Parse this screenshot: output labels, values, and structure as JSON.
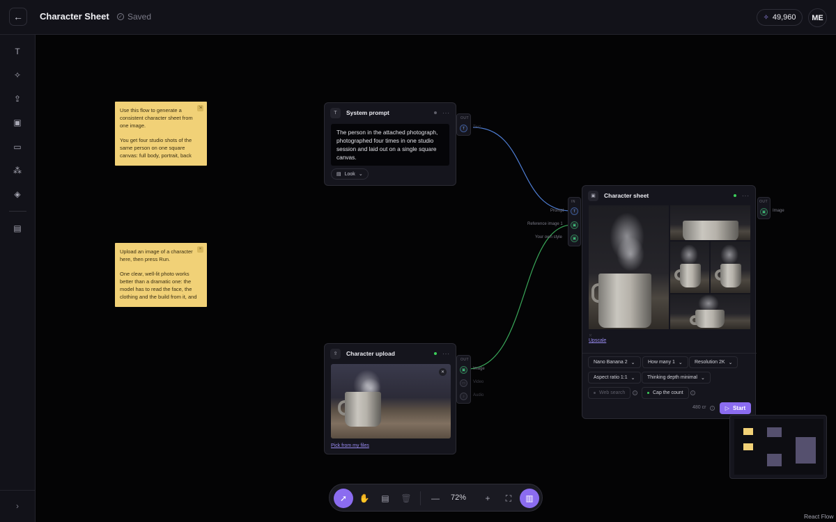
{
  "header": {
    "back_icon": "arrow-left-icon",
    "title": "Character Sheet",
    "status": "Saved",
    "credits": "49,960",
    "avatar": "ME"
  },
  "sidebar": {
    "items": [
      {
        "name": "text-tool",
        "icon": "T"
      },
      {
        "name": "sparkle-tool",
        "icon": "✧"
      },
      {
        "name": "upload-tool",
        "icon": "⇪"
      },
      {
        "name": "image-tool",
        "icon": "▣"
      },
      {
        "name": "video-tool",
        "icon": "▭"
      },
      {
        "name": "magic-wand-tool",
        "icon": "⁂"
      },
      {
        "name": "layers-tool",
        "icon": "◈"
      },
      {
        "name": "assets-tool",
        "icon": "▤"
      }
    ],
    "expand_icon": "›"
  },
  "notes": [
    {
      "p1": "Use this flow to generate a consistent character sheet from one image.",
      "p2": "You get four studio shots of the same person on one square canvas: full body, portrait, back"
    },
    {
      "p1": "Upload an image of a character here, then press Run.",
      "p2": "One clear, well-lit photo works better than a dramatic one: the model has to read the face, the clothing and the build from it, and"
    }
  ],
  "system_prompt": {
    "title": "System prompt",
    "text": "The person in the attached photograph, photographed four times in one studio session and laid out on a single square canvas.",
    "look_label": "Look",
    "out_tag": "OUT",
    "out_port": "Text"
  },
  "character_upload": {
    "title": "Character upload",
    "pick_label": "Pick from my files",
    "out_tag": "OUT",
    "ports": [
      "Image",
      "Video",
      "Audio"
    ]
  },
  "character_sheet": {
    "title": "Character sheet",
    "in_tag": "IN",
    "in_ports": [
      "Prompt",
      "Reference image 1",
      "Your own style"
    ],
    "out_tag": "OUT",
    "out_port": "Image",
    "upscale_label": "Upscale",
    "options": {
      "model": "Nano Banana 2",
      "how_many": "How many 1",
      "resolution": "Resolution 2K",
      "aspect_ratio": "Aspect ratio 1:1",
      "thinking": "Thinking depth minimal",
      "web_search": "Web search",
      "cap": "Cap the count"
    },
    "cost": "480 cr",
    "start_label": "Start"
  },
  "toolbar": {
    "zoom": "72%"
  },
  "footer": {
    "credit": "React Flow"
  },
  "colors": {
    "accent": "#8b6cf0",
    "sticky": "#f1d177",
    "status_green": "#3ccf5a",
    "text_edge": "#4f7fd6",
    "image_edge": "#3aa85a"
  }
}
